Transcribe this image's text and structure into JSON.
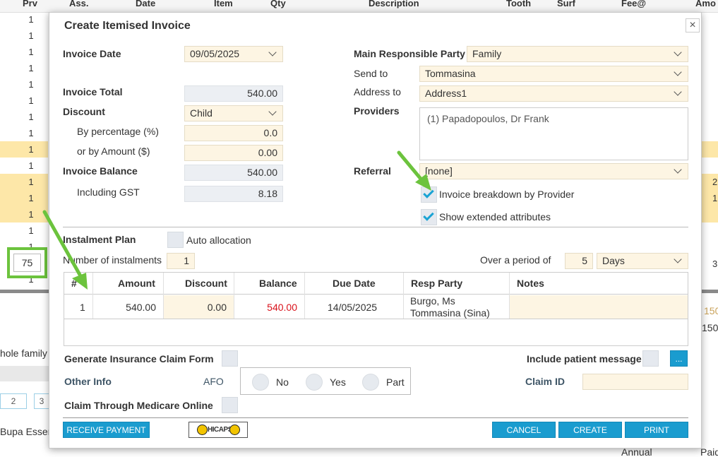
{
  "background": {
    "columns": [
      "Prv",
      "Ass.",
      "Date",
      "Item",
      "Qty",
      "Description",
      "Tooth",
      "Surf",
      "Fee@",
      "Amo"
    ],
    "prv_values": [
      "1",
      "1",
      "1",
      "1",
      "1",
      "1",
      "1",
      "1",
      "1",
      "1",
      "1",
      "1",
      "1",
      "1",
      "1",
      "1",
      "1"
    ],
    "highlighted_value": "75",
    "right_values": [
      "2",
      "1",
      "3"
    ],
    "bottom_texts": {
      "whole_family": "hole family",
      "page_2": "2",
      "page_3": "3",
      "bupa": "Bupa Essen",
      "annual": "Annual",
      "paid": "Paid",
      "amount_150_a": "150",
      "amount_150_b": "150"
    }
  },
  "dialog": {
    "title": "Create Itemised Invoice",
    "close_symbol": "×",
    "invoice_date_label": "Invoice Date",
    "invoice_date": "09/05/2025",
    "invoice_total_label": "Invoice Total",
    "invoice_total": "540.00",
    "discount_label": "Discount",
    "discount_value": "Child",
    "by_percentage_label": "By percentage (%)",
    "by_percentage": "0.0",
    "by_amount_label": "or by Amount ($)",
    "by_amount": "0.00",
    "invoice_balance_label": "Invoice Balance",
    "invoice_balance": "540.00",
    "including_gst_label": "Including GST",
    "including_gst": "8.18",
    "main_party_label": "Main Responsible Party",
    "main_party": "Family",
    "send_to_label": "Send to",
    "send_to": "Tommasina",
    "address_to_label": "Address to",
    "address_to": "Address1",
    "providers_label": "Providers",
    "providers_list": "(1) Papadopoulos, Dr Frank",
    "referral_label": "Referral",
    "referral": "[none]",
    "breakdown_label": "Invoice breakdown by Provider",
    "extended_label": "Show extended attributes",
    "instalment_plan_label": "Instalment Plan",
    "auto_allocation_label": "Auto allocation",
    "num_instalments_label": "Number of instalments",
    "num_instalments": "1",
    "over_period_label": "Over a period of",
    "period_value": "5",
    "period_unit": "Days",
    "table": {
      "headers": [
        "#",
        "Amount",
        "Discount",
        "Balance",
        "Due Date",
        "Resp Party",
        "Notes"
      ],
      "rows": [
        {
          "num": "1",
          "amount": "540.00",
          "discount": "0.00",
          "balance": "540.00",
          "due_date": "14/05/2025",
          "resp_line1": "Burgo, Ms",
          "resp_line2": "Tommasina (Sina)",
          "notes": ""
        }
      ]
    },
    "gen_claim_label": "Generate Insurance Claim Form",
    "include_msg_label": "Include patient message",
    "ellipsis": "...",
    "other_info_label": "Other Info",
    "afo_label": "AFO",
    "radio_no": "No",
    "radio_yes": "Yes",
    "radio_part": "Part",
    "claim_id_label": "Claim ID",
    "medicare_label": "Claim Through Medicare Online",
    "receive_payment": "RECEIVE PAYMENT",
    "hicaps_logo": "HICAPS",
    "cancel": "CANCEL",
    "create": "CREATE",
    "print": "PRINT"
  },
  "colors": {
    "accent": "#1a9ccf",
    "field_bg": "#fdf5e3",
    "readonly_bg": "#eceff3",
    "balance_red": "#d9121b",
    "annotation_green": "#6cc33d",
    "row_highlight": "#fde7a8"
  }
}
